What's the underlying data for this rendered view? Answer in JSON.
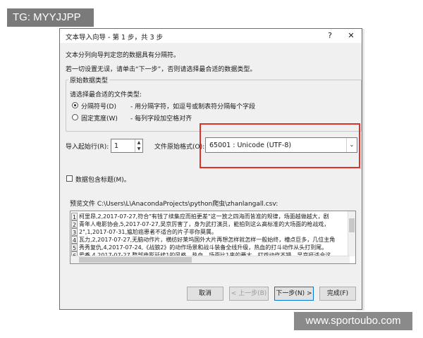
{
  "watermark": "TG: MYYJJPP",
  "watermark_bottom": "www.sportoubo.com",
  "background_side_text": "表",
  "dialog": {
    "title": "文本导入向导 - 第 1 步，共 3 步",
    "help_label": "?",
    "close_label": "✕",
    "intro_line1": "文本分列向导判定您的数据具有分隔符。",
    "intro_line2": "若一切设置无误，请单击“下一步”，否则请选择最合适的数据类型。",
    "group_title": "原始数据类型",
    "group_prompt": "请选择最合适的文件类型:",
    "radio_delimited_label": "分隔符号(D)",
    "radio_delimited_desc": "- 用分隔字符，如逗号或制表符分隔每个字段",
    "radio_fixed_label": "固定宽度(W)",
    "radio_fixed_desc": "- 每列字段加空格对齐",
    "start_row_label": "导入起始行(R):",
    "start_row_value": "1",
    "origin_label": "文件原始格式(O):",
    "origin_value": "65001 : Unicode (UTF-8)",
    "headers_checkbox_label": "数据包含标题(M)。",
    "preview_label": "预览文件 C:\\Users\\L\\AnacondaProjects\\python爬虫\\zhanlangall.csv:",
    "preview_row_numbers": [
      "1",
      "2",
      "3",
      "4",
      "5",
      "6",
      "7"
    ],
    "preview_lines": [
      "柯里昂,2,2017-07-27,符合\"有钱了续集应而拍更差\"这一放之四海而皆准的规律，场面越做越大，剧",
      "青年人电影协会,5,2017-07-27,吴京厉害了，身为武打演员，能拍到这么高标准的大场面的枪战戏，",
      "2\",1,2017-07-31,尴尬癌患者不适合的片子非你莫属。",
      "瓦力,2,2017-07-27,无脑动作片，横纺好莱坞国外大片再想怎样就怎样一般始终，槽点巨多，几位主角",
      "秀秀复仇,4,2017-07-24,《战狼2》的动作场景和战斗装备全线升级，热血的打斗动作从头打到尾。",
      "爱香,4,2017-07-27,整部电影延续1的风格，热血。场面比1来的要大，打戏动作不错，吴京挺适合这",
      "婷绒,2,2017-08-01,【C】剧本学好莱坞已经学的比较像样，但其他导演层面上的东西，处处呈现着"
    ],
    "buttons": {
      "cancel": "取消",
      "prev": "< 上一步(B)",
      "next": "下一步(N) >",
      "finish": "完成(F)"
    }
  },
  "colors": {
    "highlight_box": "#e0302a",
    "default_button_border": "#0078d7"
  }
}
